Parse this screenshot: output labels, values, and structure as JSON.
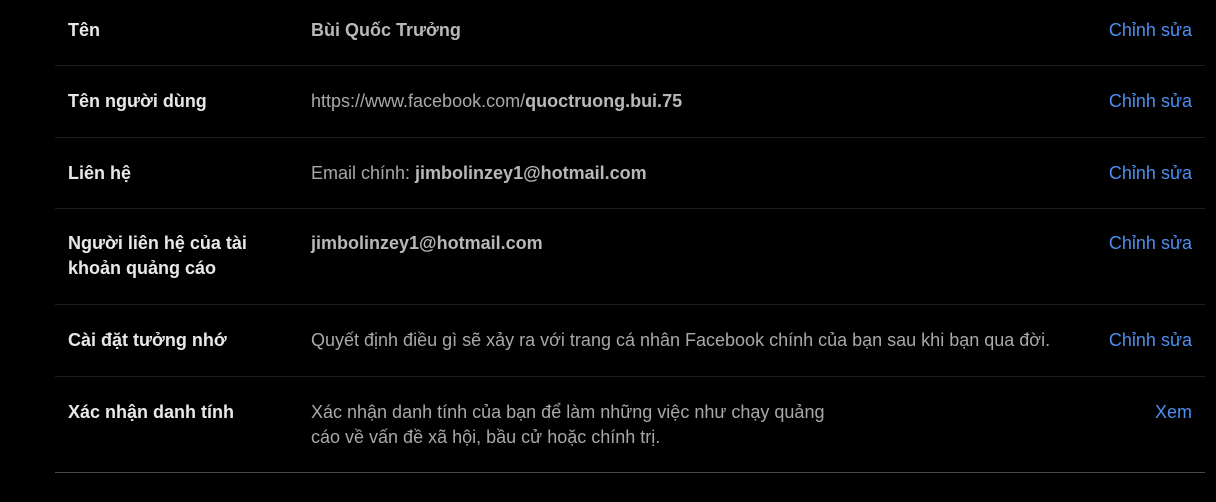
{
  "rows": [
    {
      "label": "Tên",
      "value": "Bùi Quốc Trưởng",
      "action": "Chỉnh sửa"
    },
    {
      "label": "Tên người dùng",
      "value_prefix": "https://www.facebook.com/",
      "value_bold": "quoctruong.bui.75",
      "action": "Chỉnh sửa"
    },
    {
      "label": "Liên hệ",
      "value_prefix": "Email chính: ",
      "value_bold": "jimbolinzey1@hotmail.com",
      "action": "Chỉnh sửa"
    },
    {
      "label_line1": "Người liên hệ của tài",
      "label_line2": "khoản quảng cáo",
      "value": "jimbolinzey1@hotmail.com",
      "action": "Chỉnh sửa"
    },
    {
      "label": "Cài đặt tưởng nhớ",
      "value": "Quyết định điều gì sẽ xảy ra với trang cá nhân Facebook chính của bạn sau khi bạn qua đời.",
      "action": "Chỉnh sửa"
    },
    {
      "label": "Xác nhận danh tính",
      "value_line1": "Xác nhận danh tính của bạn để làm những việc như chạy quảng",
      "value_line2": "cáo về vấn đề xã hội, bầu cử hoặc chính trị.",
      "action": "Xem"
    }
  ]
}
